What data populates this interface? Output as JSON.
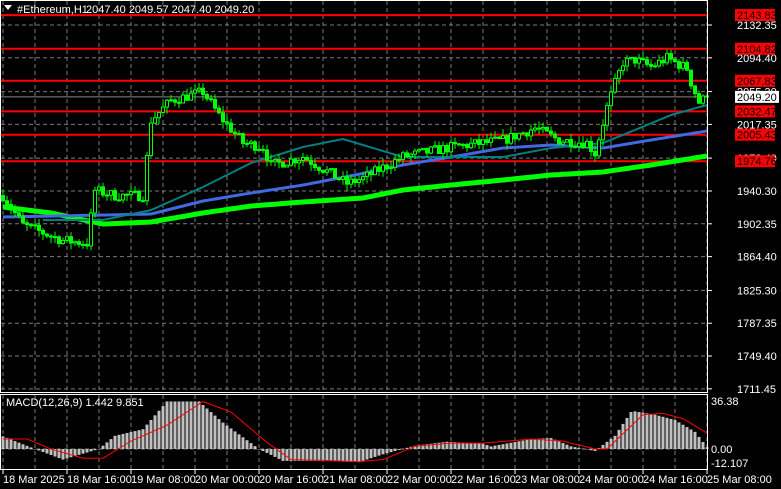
{
  "header": {
    "symbol": "#Ethereum,H1",
    "ohlc": "2047.40 2049.57 2047.40 2049.20"
  },
  "macd_label": "MACD(12,26,9) 1.442 9.851",
  "colors": {
    "bull": "#00ff00",
    "level": "#ff0000",
    "ma_fast": "#008080",
    "ma_mid": "#4169e1",
    "ma_slow": "#00ff00",
    "hist": "#c0c0c0",
    "signal": "#ff0000"
  },
  "chart_data": {
    "type": "candlestick",
    "title": "#Ethereum,H1",
    "timeframe": "H1",
    "price_ticks": [
      "2132.35",
      "2094.40",
      "2055.30",
      "2017.35",
      "1978.40",
      "1940.30",
      "1902.35",
      "1864.40",
      "1825.30",
      "1787.35",
      "1749.40",
      "1711.45"
    ],
    "price_tick_values": [
      2132.35,
      2094.4,
      2055.3,
      2017.35,
      1978.4,
      1940.3,
      1902.35,
      1864.4,
      1825.3,
      1787.35,
      1749.4,
      1711.45
    ],
    "ylim": [
      1711.45,
      2150
    ],
    "time_labels": [
      "18 Mar 2025",
      "18 Mar 16:00",
      "19 Mar 08:00",
      "20 Mar 00:00",
      "20 Mar 16:00",
      "21 Mar 08:00",
      "22 Mar 00:00",
      "22 Mar 16:00",
      "23 Mar 08:00",
      "24 Mar 00:00",
      "24 Mar 16:00",
      "25 Mar 08:00"
    ],
    "bars_total": 177,
    "current_price": "2049.20",
    "levels": [
      "2143.83",
      "2104.82",
      "2067.83",
      "2032.47",
      "2005.43",
      "1974.76"
    ],
    "close_waypoints": [
      [
        0,
        1935
      ],
      [
        5,
        1901
      ],
      [
        15,
        1883
      ],
      [
        21,
        1880
      ],
      [
        23,
        1941
      ],
      [
        28,
        1935
      ],
      [
        35,
        1935
      ],
      [
        37,
        2022
      ],
      [
        42,
        2045
      ],
      [
        50,
        2055
      ],
      [
        54,
        2028
      ],
      [
        60,
        1996
      ],
      [
        65,
        1991
      ],
      [
        67,
        1970
      ],
      [
        72,
        1976
      ],
      [
        75,
        1980
      ],
      [
        86,
        1949
      ],
      [
        90,
        1955
      ],
      [
        100,
        1980
      ],
      [
        112,
        1991
      ],
      [
        125,
        1999
      ],
      [
        133,
        2013
      ],
      [
        139,
        1999
      ],
      [
        146,
        1996
      ],
      [
        148,
        1984
      ],
      [
        151,
        2037
      ],
      [
        153,
        2065
      ],
      [
        155,
        2089
      ],
      [
        158,
        2092
      ],
      [
        162,
        2084
      ],
      [
        166,
        2094
      ],
      [
        171,
        2082
      ],
      [
        172,
        2066
      ],
      [
        174,
        2043
      ],
      [
        176,
        2049.2
      ]
    ],
    "ma_fast": [
      [
        10,
        1906.8
      ],
      [
        25,
        1906.8
      ],
      [
        37,
        1918.3
      ],
      [
        50,
        1944.9
      ],
      [
        62,
        1972.7
      ],
      [
        75,
        1991.2
      ],
      [
        85,
        2000.5
      ],
      [
        100,
        1979.6
      ],
      [
        125,
        1979.6
      ],
      [
        137,
        1990
      ],
      [
        150,
        1995.8
      ],
      [
        158,
        2010.9
      ],
      [
        167,
        2028.2
      ],
      [
        176,
        2039.8
      ]
    ],
    "ma_mid": [
      [
        0,
        1910.2
      ],
      [
        25,
        1912.5
      ],
      [
        37,
        1913.7
      ],
      [
        50,
        1928.7
      ],
      [
        62,
        1938
      ],
      [
        75,
        1947.2
      ],
      [
        88,
        1958.8
      ],
      [
        100,
        1970.4
      ],
      [
        112,
        1979.6
      ],
      [
        125,
        1990
      ],
      [
        137,
        1993.5
      ],
      [
        150,
        1990
      ],
      [
        162,
        1999.3
      ],
      [
        176,
        2009.7
      ]
    ],
    "ma_slow": [
      [
        0,
        1921.8
      ],
      [
        12,
        1914.9
      ],
      [
        25,
        1902.1
      ],
      [
        37,
        1904.4
      ],
      [
        50,
        1914.9
      ],
      [
        62,
        1922.9
      ],
      [
        75,
        1927.6
      ],
      [
        90,
        1932.2
      ],
      [
        100,
        1941.5
      ],
      [
        112,
        1947.2
      ],
      [
        125,
        1953
      ],
      [
        137,
        1958.8
      ],
      [
        150,
        1962.3
      ],
      [
        162,
        1970.4
      ],
      [
        176,
        1980.8
      ]
    ],
    "macd": {
      "label": "MACD(12,26,9) 1.442 9.851",
      "ticks": [
        "36.38",
        "0.00",
        "-12.107"
      ],
      "ylim": [
        -12.107,
        36.38
      ],
      "histogram": [
        [
          0,
          9.6
        ],
        [
          8,
          0
        ],
        [
          15,
          -8
        ],
        [
          24,
          0
        ],
        [
          28,
          10
        ],
        [
          35,
          15
        ],
        [
          41,
          36
        ],
        [
          49,
          36
        ],
        [
          55,
          20
        ],
        [
          64,
          0
        ],
        [
          70,
          -9
        ],
        [
          80,
          -9
        ],
        [
          89,
          -10
        ],
        [
          95,
          -4
        ],
        [
          103,
          2.5
        ],
        [
          111,
          5.5
        ],
        [
          120,
          4
        ],
        [
          122,
          2
        ],
        [
          132,
          7.5
        ],
        [
          137,
          8.3
        ],
        [
          142,
          2
        ],
        [
          148,
          -1.5
        ],
        [
          153,
          10
        ],
        [
          157,
          28
        ],
        [
          158,
          28.5
        ],
        [
          163,
          26
        ],
        [
          168,
          22
        ],
        [
          173,
          13
        ],
        [
          176,
          1.4
        ]
      ],
      "signal": [
        [
          0,
          7.6
        ],
        [
          6,
          7.6
        ],
        [
          12,
          0
        ],
        [
          20,
          -7
        ],
        [
          25,
          -7
        ],
        [
          32,
          6
        ],
        [
          41,
          18
        ],
        [
          50,
          36
        ],
        [
          57,
          28
        ],
        [
          66,
          5
        ],
        [
          72,
          -8
        ],
        [
          80,
          -8.6
        ],
        [
          89,
          -9.6
        ],
        [
          95,
          -8
        ],
        [
          103,
          2
        ],
        [
          112,
          4.5
        ],
        [
          120,
          4.5
        ],
        [
          132,
          7.5
        ],
        [
          140,
          6
        ],
        [
          148,
          0
        ],
        [
          151,
          0
        ],
        [
          160,
          26
        ],
        [
          165,
          27
        ],
        [
          170,
          23
        ],
        [
          176,
          12
        ]
      ]
    }
  }
}
